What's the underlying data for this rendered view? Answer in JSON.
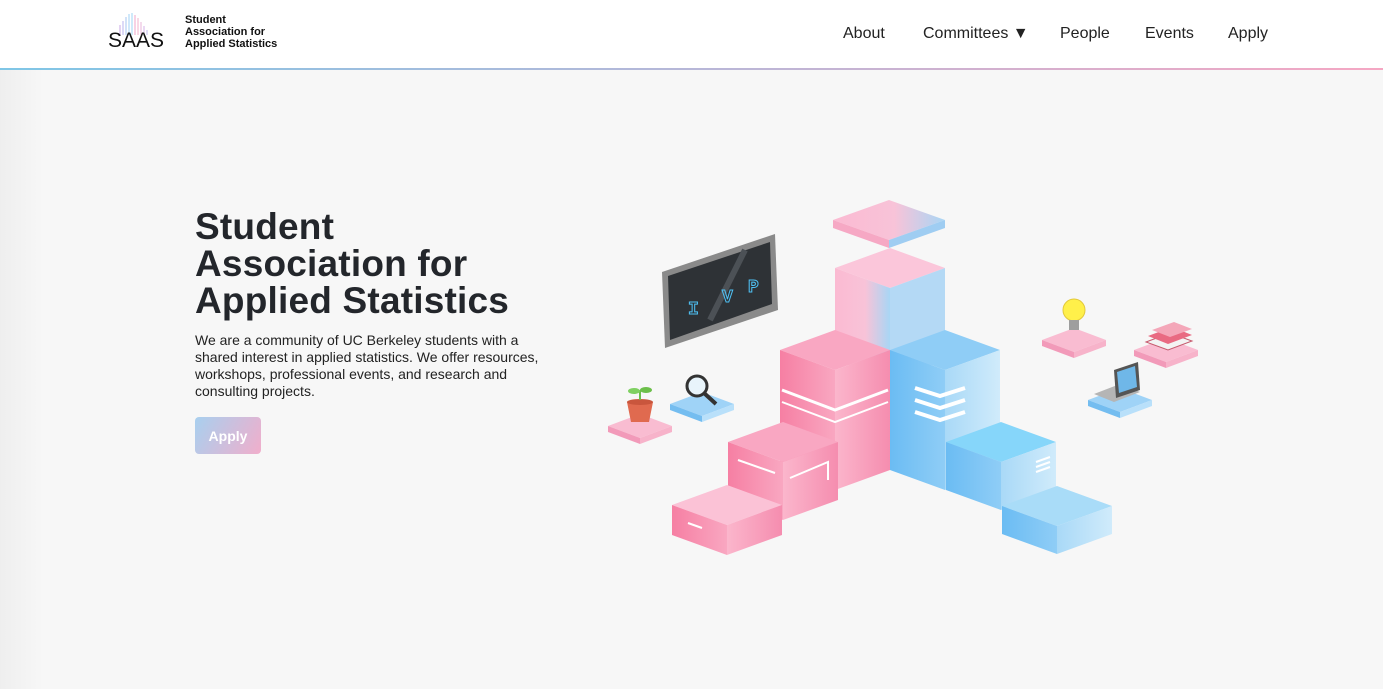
{
  "nav": {
    "logo_mark": "SAAS",
    "logo_lines": [
      "Student",
      "Association for",
      "Applied Statistics"
    ],
    "items": [
      {
        "label": "About"
      },
      {
        "label": "Committees ▼"
      },
      {
        "label": "People"
      },
      {
        "label": "Events"
      },
      {
        "label": "Apply"
      }
    ]
  },
  "hero": {
    "title_lines": [
      "Student",
      "Association for",
      "Applied Statistics"
    ],
    "description": "We are a community of UC Berkeley students with a shared interest in applied statistics. We offer resources, workshops, professional events, and research and consulting projects.",
    "apply_label": "Apply"
  },
  "illustration": {
    "board_text": [
      "I",
      "V",
      "P"
    ]
  },
  "colors": {
    "pink": "#f48fb1",
    "blue": "#64b5f6",
    "dark_text": "#23262b"
  }
}
